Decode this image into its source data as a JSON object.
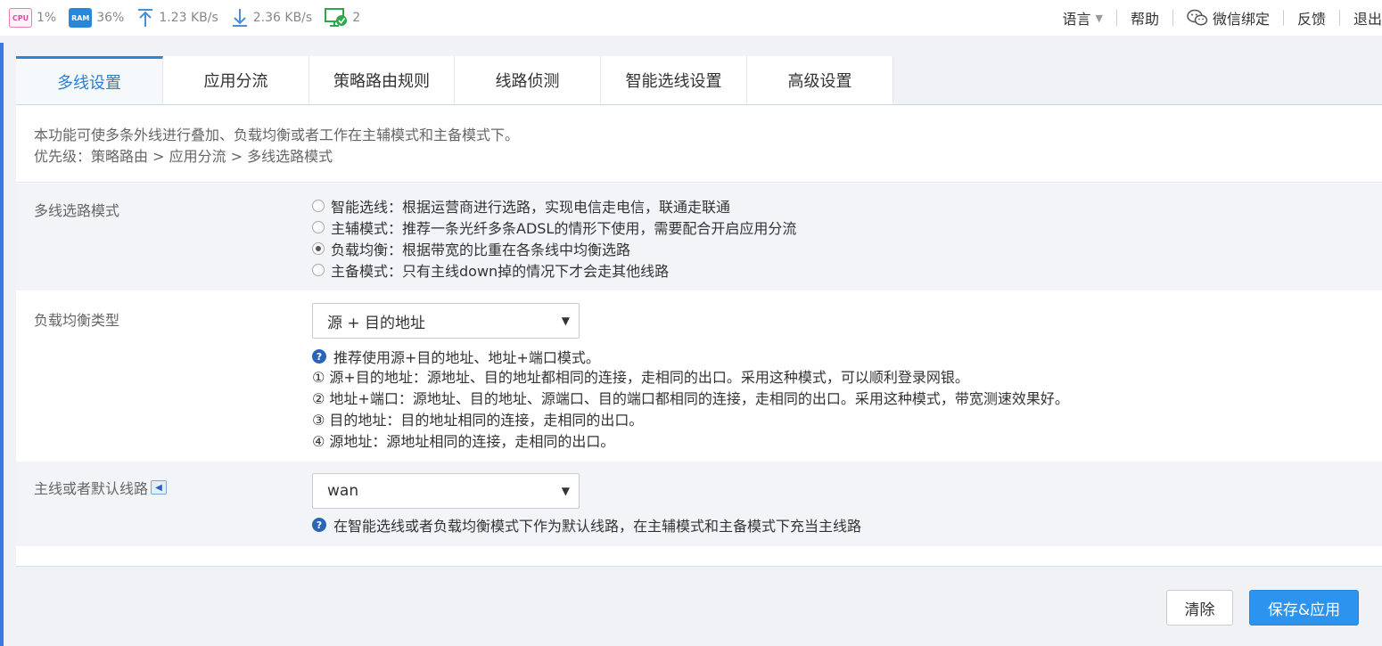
{
  "status": {
    "cpu_icon_text": "CPU",
    "cpu": "1%",
    "ram_icon_text": "RAM",
    "ram": "36%",
    "upload": "1.23 KB/s",
    "download": "2.36 KB/s",
    "devices": "2"
  },
  "topmenu": {
    "language": "语言",
    "help": "帮助",
    "wechat": "微信绑定",
    "feedback": "反馈",
    "logout": "退出"
  },
  "tabs": [
    {
      "label": "多线设置"
    },
    {
      "label": "应用分流"
    },
    {
      "label": "策略路由规则"
    },
    {
      "label": "线路侦测"
    },
    {
      "label": "智能选线设置"
    },
    {
      "label": "高级设置"
    }
  ],
  "intro": {
    "line1": "本功能可使多条外线进行叠加、负载均衡或者工作在主辅模式和主备模式下。",
    "line2": "优先级：策略路由 > 应用分流 > 多线选路模式"
  },
  "mode": {
    "label": "多线选路模式",
    "options": [
      {
        "text": "智能选线：根据运营商进行选路，实现电信走电信，联通走联通"
      },
      {
        "text": "主辅模式：推荐一条光纤多条ADSL的情形下使用，需要配合开启应用分流"
      },
      {
        "text": "负载均衡：根据带宽的比重在各条线中均衡选路"
      },
      {
        "text": "主备模式：只有主线down掉的情况下才会走其他线路"
      }
    ],
    "selected_index": 2
  },
  "balance": {
    "label": "负载均衡类型",
    "selected": "源 + 目的地址",
    "help": "推荐使用源+目的地址、地址+端口模式。",
    "notes": [
      "① 源+目的地址：源地址、目的地址都相同的连接，走相同的出口。采用这种模式，可以顺利登录网银。",
      "② 地址+端口：源地址、目的地址、源端口、目的端口都相同的连接，走相同的出口。采用这种模式，带宽测速效果好。",
      "③ 目的地址：目的地址相同的连接，走相同的出口。",
      "④ 源地址：源地址相同的连接，走相同的出口。"
    ]
  },
  "default_line": {
    "label": "主线或者默认线路",
    "selected": "wan",
    "help": "在智能选线或者负载均衡模式下作为默认线路，在主辅模式和主备模式下充当主线路"
  },
  "buttons": {
    "clear": "清除",
    "save": "保存&应用"
  },
  "colors": {
    "accent": "#2c93ee",
    "active_tab_text": "#2a7fd4",
    "help_icon": "#2a64b8"
  }
}
